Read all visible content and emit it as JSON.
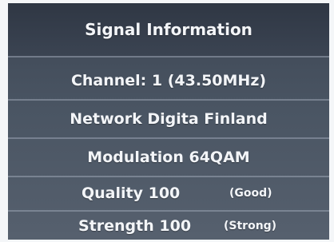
{
  "osd": {
    "title": "Signal Information",
    "channel": "Channel: 1 (43.50MHz)",
    "network": "Network Digita Finland",
    "modulation": "Modulation 64QAM",
    "quality": {
      "label": "Quality 100",
      "status": "(Good)"
    },
    "strength": {
      "label": "Strength 100",
      "status": "(Strong)"
    }
  },
  "colors": {
    "panel_top": "#3d4654",
    "panel_bottom": "#56606e",
    "text": "#f3f5f8"
  }
}
